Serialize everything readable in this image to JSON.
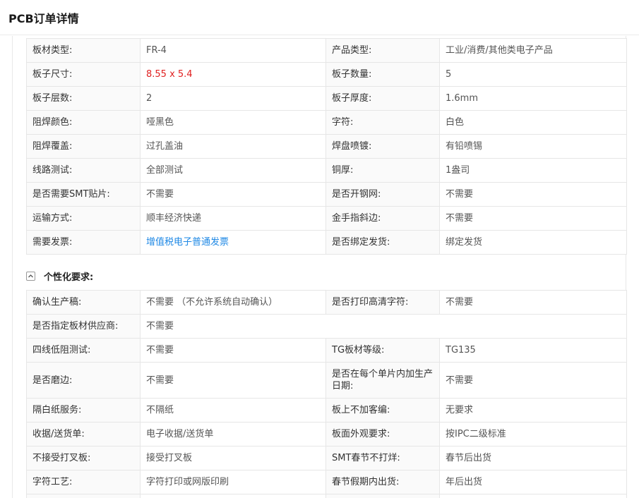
{
  "page": {
    "title": "PCB订单详情"
  },
  "basic_specs": {
    "rows": [
      [
        {
          "label": "板材类型:",
          "value": "FR-4"
        },
        {
          "label": "产品类型:",
          "value": "工业/消费/其他类电子产品"
        }
      ],
      [
        {
          "label": "板子尺寸:",
          "value": "8.55 x 5.4",
          "highlight": "red"
        },
        {
          "label": "板子数量:",
          "value": "5"
        }
      ],
      [
        {
          "label": "板子层数:",
          "value": "2"
        },
        {
          "label": "板子厚度:",
          "value": "1.6mm"
        }
      ],
      [
        {
          "label": "阻焊颜色:",
          "value": "哑黑色"
        },
        {
          "label": "字符:",
          "value": "白色"
        }
      ],
      [
        {
          "label": "阻焊覆盖:",
          "value": "过孔盖油"
        },
        {
          "label": "焊盘喷镀:",
          "value": "有铅喷锡"
        }
      ],
      [
        {
          "label": "线路测试:",
          "value": "全部测试"
        },
        {
          "label": "铜厚:",
          "value": "1盎司"
        }
      ],
      [
        {
          "label": "是否需要SMT贴片:",
          "value": "不需要"
        },
        {
          "label": "是否开钢网:",
          "value": "不需要"
        }
      ],
      [
        {
          "label": "运输方式:",
          "value": "顺丰经济快递"
        },
        {
          "label": "金手指斜边:",
          "value": "不需要"
        }
      ],
      [
        {
          "label": "需要发票:",
          "value": "增值税电子普通发票",
          "link": true
        },
        {
          "label": "是否绑定发货:",
          "value": "绑定发货"
        }
      ]
    ]
  },
  "personalized": {
    "section_title": "个性化要求:",
    "collapse_icon": "chevron-up-icon",
    "rows": [
      [
        {
          "label": "确认生产稿:",
          "value": "不需要  （不允许系统自动确认）"
        },
        {
          "label": "是否打印高清字符:",
          "value": "不需要"
        }
      ],
      [
        {
          "label": "是否指定板材供应商:",
          "value": "不需要",
          "full": true
        }
      ],
      [
        {
          "label": "四线低阻测试:",
          "value": "不需要"
        },
        {
          "label": "TG板材等级:",
          "value": "TG135"
        }
      ],
      [
        {
          "label": "是否磨边:",
          "value": "不需要"
        },
        {
          "label": "是否在每个单片内加生产日期:",
          "value": "不需要"
        }
      ],
      [
        {
          "label": "隔白纸服务:",
          "value": "不隔纸"
        },
        {
          "label": "板上不加客编:",
          "value": "无要求"
        }
      ],
      [
        {
          "label": "收据/送货单:",
          "value": "电子收据/送货单"
        },
        {
          "label": "板面外观要求:",
          "value": "按IPC二级标准"
        }
      ],
      [
        {
          "label": "不接受打叉板:",
          "value": "接受打叉板"
        },
        {
          "label": "SMT春节不打烊:",
          "value": "春节后出货"
        }
      ],
      [
        {
          "label": "字符工艺:",
          "value": "字符打印或网版印刷"
        },
        {
          "label": "春节假期内出货:",
          "value": "年后出货"
        }
      ],
      [
        {
          "label": "",
          "value": ""
        },
        {
          "label": "",
          "value": ""
        }
      ]
    ]
  },
  "colors": {
    "accent_red": "#e02020",
    "link_blue": "#1e88e5",
    "label_bg": "#fafafa",
    "border": "#e6e6e6"
  }
}
